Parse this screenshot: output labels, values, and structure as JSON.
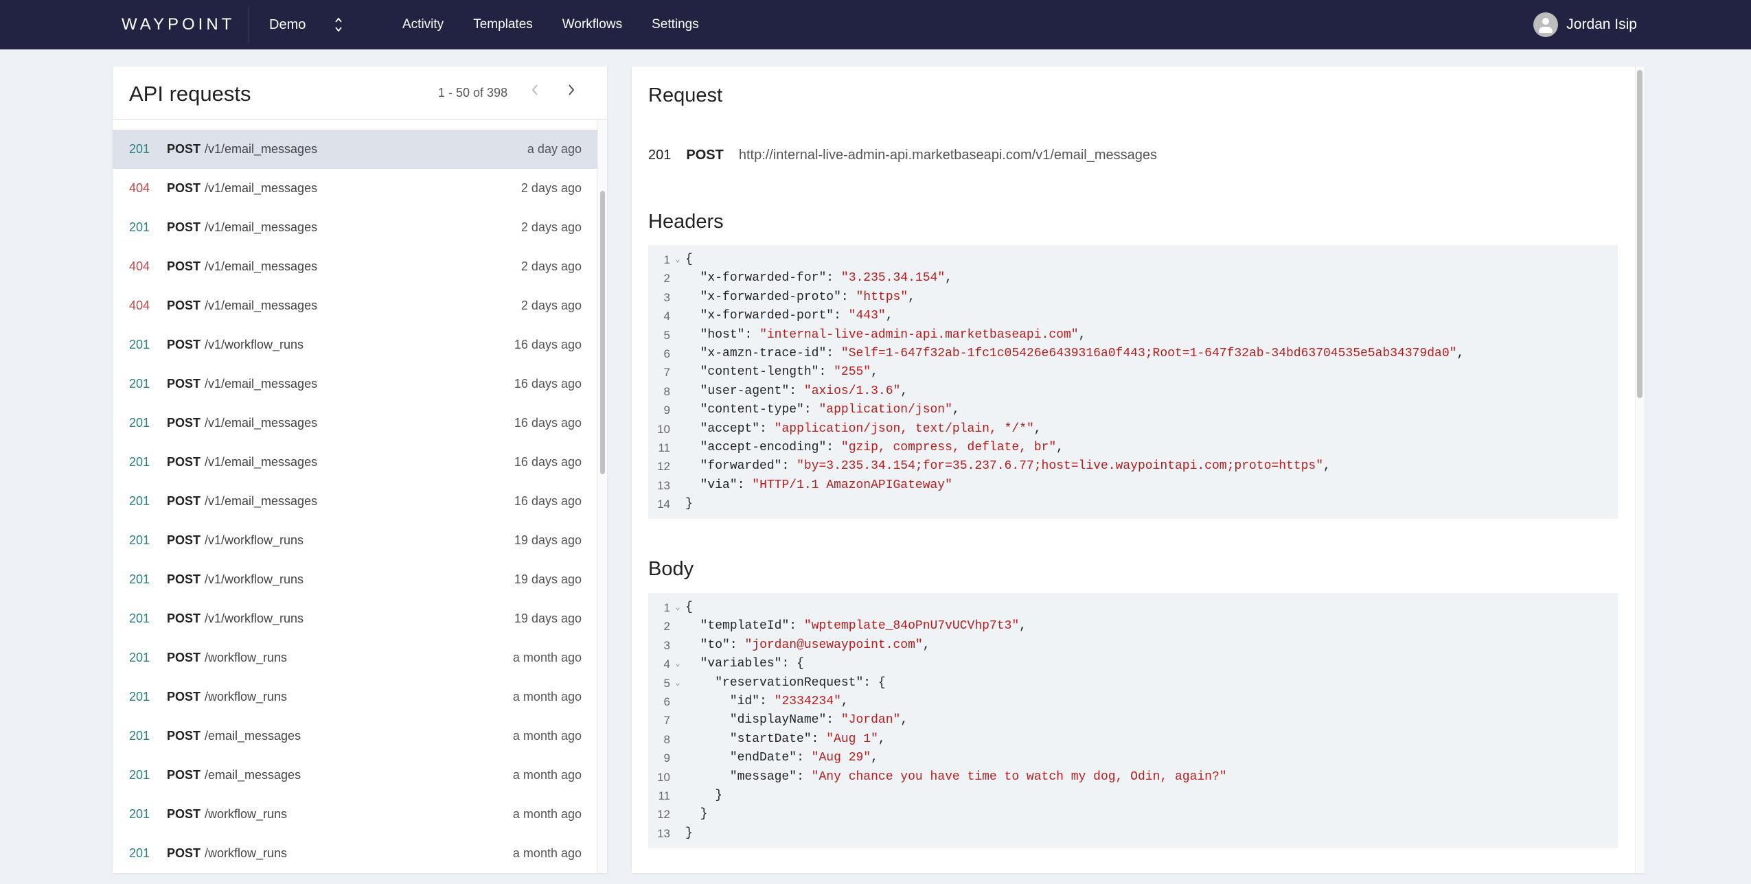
{
  "nav": {
    "brand": "WAYPOINT",
    "org": "Demo",
    "org_switch_icon": "chevron-up-down-icon",
    "links": [
      "Activity",
      "Templates",
      "Workflows",
      "Settings"
    ],
    "user_name": "Jordan Isip",
    "avatar_icon": "person-icon"
  },
  "left": {
    "title": "API requests",
    "pager": "1 - 50 of 398",
    "prev_icon": "chevron-left-icon",
    "next_icon": "chevron-right-icon",
    "requests": [
      {
        "status": "201",
        "method": "POST",
        "path": "/v1/email_messages",
        "time": "a day ago",
        "selected": true
      },
      {
        "status": "404",
        "method": "POST",
        "path": "/v1/email_messages",
        "time": "2 days ago"
      },
      {
        "status": "201",
        "method": "POST",
        "path": "/v1/email_messages",
        "time": "2 days ago"
      },
      {
        "status": "404",
        "method": "POST",
        "path": "/v1/email_messages",
        "time": "2 days ago"
      },
      {
        "status": "404",
        "method": "POST",
        "path": "/v1/email_messages",
        "time": "2 days ago"
      },
      {
        "status": "201",
        "method": "POST",
        "path": "/v1/workflow_runs",
        "time": "16 days ago"
      },
      {
        "status": "201",
        "method": "POST",
        "path": "/v1/email_messages",
        "time": "16 days ago"
      },
      {
        "status": "201",
        "method": "POST",
        "path": "/v1/email_messages",
        "time": "16 days ago"
      },
      {
        "status": "201",
        "method": "POST",
        "path": "/v1/email_messages",
        "time": "16 days ago"
      },
      {
        "status": "201",
        "method": "POST",
        "path": "/v1/email_messages",
        "time": "16 days ago"
      },
      {
        "status": "201",
        "method": "POST",
        "path": "/v1/workflow_runs",
        "time": "19 days ago"
      },
      {
        "status": "201",
        "method": "POST",
        "path": "/v1/workflow_runs",
        "time": "19 days ago"
      },
      {
        "status": "201",
        "method": "POST",
        "path": "/v1/workflow_runs",
        "time": "19 days ago"
      },
      {
        "status": "201",
        "method": "POST",
        "path": "/workflow_runs",
        "time": "a month ago"
      },
      {
        "status": "201",
        "method": "POST",
        "path": "/workflow_runs",
        "time": "a month ago"
      },
      {
        "status": "201",
        "method": "POST",
        "path": "/email_messages",
        "time": "a month ago"
      },
      {
        "status": "201",
        "method": "POST",
        "path": "/email_messages",
        "time": "a month ago"
      },
      {
        "status": "201",
        "method": "POST",
        "path": "/workflow_runs",
        "time": "a month ago"
      },
      {
        "status": "201",
        "method": "POST",
        "path": "/workflow_runs",
        "time": "a month ago"
      }
    ]
  },
  "detail": {
    "request_title": "Request",
    "status": "201",
    "method": "POST",
    "url": "http://internal-live-admin-api.marketbaseapi.com/v1/email_messages",
    "headers_title": "Headers",
    "headers_lines": [
      {
        "n": "1",
        "fold": true,
        "indent": 0,
        "text": "{"
      },
      {
        "n": "2",
        "indent": 1,
        "key": "x-forwarded-for",
        "value": "3.235.34.154",
        "comma": true
      },
      {
        "n": "3",
        "indent": 1,
        "key": "x-forwarded-proto",
        "value": "https",
        "comma": true
      },
      {
        "n": "4",
        "indent": 1,
        "key": "x-forwarded-port",
        "value": "443",
        "comma": true
      },
      {
        "n": "5",
        "indent": 1,
        "key": "host",
        "value": "internal-live-admin-api.marketbaseapi.com",
        "comma": true
      },
      {
        "n": "6",
        "indent": 1,
        "key": "x-amzn-trace-id",
        "value": "Self=1-647f32ab-1fc1c05426e6439316a0f443;Root=1-647f32ab-34bd63704535e5ab34379da0",
        "comma": true
      },
      {
        "n": "7",
        "indent": 1,
        "key": "content-length",
        "value": "255",
        "comma": true
      },
      {
        "n": "8",
        "indent": 1,
        "key": "user-agent",
        "value": "axios/1.3.6",
        "comma": true
      },
      {
        "n": "9",
        "indent": 1,
        "key": "content-type",
        "value": "application/json",
        "comma": true
      },
      {
        "n": "10",
        "indent": 1,
        "key": "accept",
        "value": "application/json, text/plain, */*",
        "comma": true
      },
      {
        "n": "11",
        "indent": 1,
        "key": "accept-encoding",
        "value": "gzip, compress, deflate, br",
        "comma": true
      },
      {
        "n": "12",
        "indent": 1,
        "key": "forwarded",
        "value": "by=3.235.34.154;for=35.237.6.77;host=live.waypointapi.com;proto=https",
        "comma": true
      },
      {
        "n": "13",
        "indent": 1,
        "key": "via",
        "value": "HTTP/1.1 AmazonAPIGateway",
        "comma": false
      },
      {
        "n": "14",
        "indent": 0,
        "text": "}"
      }
    ],
    "body_title": "Body",
    "body_lines": [
      {
        "n": "1",
        "fold": true,
        "indent": 0,
        "text": "{"
      },
      {
        "n": "2",
        "indent": 1,
        "key": "templateId",
        "value": "wptemplate_84oPnU7vUCVhp7t3",
        "comma": true
      },
      {
        "n": "3",
        "indent": 1,
        "key": "to",
        "value": "jordan@usewaypoint.com",
        "comma": true
      },
      {
        "n": "4",
        "fold": true,
        "indent": 1,
        "key": "variables",
        "open": "{"
      },
      {
        "n": "5",
        "fold": true,
        "indent": 2,
        "key": "reservationRequest",
        "open": "{"
      },
      {
        "n": "6",
        "indent": 3,
        "key": "id",
        "value": "2334234",
        "comma": true
      },
      {
        "n": "7",
        "indent": 3,
        "key": "displayName",
        "value": "Jordan",
        "comma": true
      },
      {
        "n": "8",
        "indent": 3,
        "key": "startDate",
        "value": "Aug 1",
        "comma": true
      },
      {
        "n": "9",
        "indent": 3,
        "key": "endDate",
        "value": "Aug 29",
        "comma": true
      },
      {
        "n": "10",
        "indent": 3,
        "key": "message",
        "value": "Any chance you have time to watch my dog, Odin, again?",
        "comma": false
      },
      {
        "n": "11",
        "indent": 2,
        "text": "}"
      },
      {
        "n": "12",
        "indent": 1,
        "text": "}"
      },
      {
        "n": "13",
        "indent": 0,
        "text": "}"
      }
    ]
  },
  "colors": {
    "nav_bg": "#222343",
    "status_ok": "#2a8080",
    "status_err": "#c0474a",
    "code_string": "#b71c1c",
    "code_bg": "#f0f3f6",
    "selected_row": "#dde2ea"
  }
}
